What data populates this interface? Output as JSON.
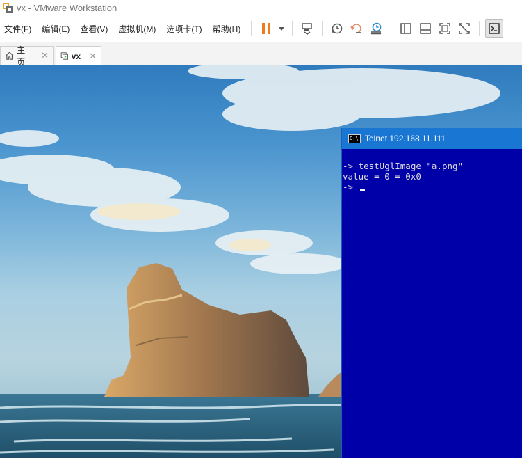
{
  "window": {
    "title": "vx - VMware Workstation"
  },
  "menu": {
    "items": [
      "文件(F)",
      "编辑(E)",
      "查看(V)",
      "虚拟机(M)",
      "选项卡(T)",
      "帮助(H)"
    ]
  },
  "toolbar": {
    "icons": [
      "pause-icon",
      "dropdown-caret-icon",
      "send-ctrl-alt-del-icon",
      "snapshot-icon",
      "revert-snapshot-icon",
      "snapshot-manager-icon",
      "library-view-icon",
      "thumbnail-view-icon",
      "fullscreen-icon",
      "unity-icon",
      "console-view-icon"
    ],
    "accent": "#f07b1e"
  },
  "tabs": [
    {
      "label": "主页",
      "icon": "home-icon",
      "active": false
    },
    {
      "label": "vx",
      "icon": "vm-icon",
      "active": true
    }
  ],
  "telnet": {
    "title": "Telnet 192.168.11.111",
    "lines": [
      "-> testUglImage \"a.png\"",
      "value = 0 = 0x0",
      "-> "
    ],
    "background": "#0000a8",
    "titlebar_color": "#1976d2"
  }
}
